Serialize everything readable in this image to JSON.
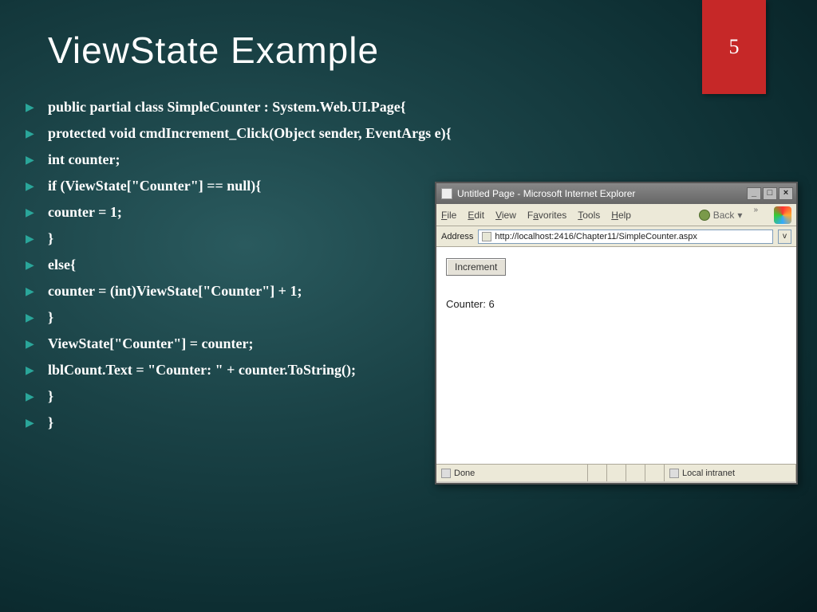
{
  "slide": {
    "title": "ViewState Example",
    "page_number": "5"
  },
  "code_lines": [
    "public partial class SimpleCounter : System.Web.UI.Page{",
    "protected void cmdIncrement_Click(Object sender, EventArgs e){",
    "int counter;",
    "if (ViewState[\"Counter\"] == null){",
    "counter = 1;",
    "}",
    "else{",
    "counter = (int)ViewState[\"Counter\"] + 1;",
    "}",
    "ViewState[\"Counter\"] = counter;",
    "lblCount.Text = \"Counter: \" + counter.ToString();",
    "}",
    "}"
  ],
  "browser": {
    "title": "Untitled Page - Microsoft Internet Explorer",
    "menus": {
      "file": "File",
      "edit": "Edit",
      "view": "View",
      "favorites": "Favorites",
      "tools": "Tools",
      "help": "Help"
    },
    "back_label": "Back",
    "address_label": "Address",
    "url": "http://localhost:2416/Chapter11/SimpleCounter.aspx",
    "button_label": "Increment",
    "counter_text": "Counter: 6",
    "status_done": "Done",
    "status_zone": "Local intranet"
  }
}
